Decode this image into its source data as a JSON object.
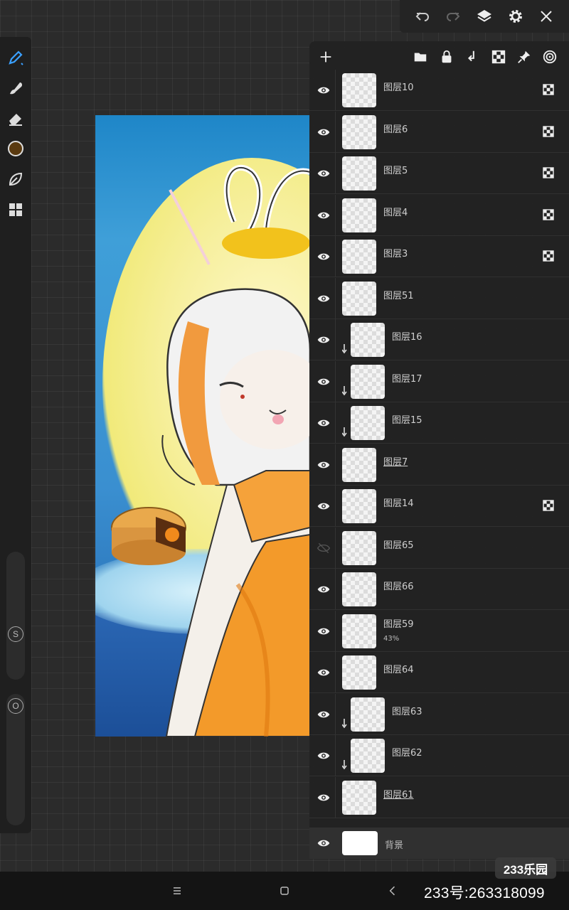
{
  "top_bar": {
    "icons": [
      "undo-icon",
      "redo-icon",
      "layers-icon",
      "gear-icon",
      "close-icon"
    ]
  },
  "left_rail": {
    "tools": [
      "brush-icon",
      "smudge-icon",
      "eraser-icon",
      "color-swatch",
      "leaf-icon",
      "grid-icon"
    ],
    "current_color": "#5a3a10",
    "size_slider_label": "S",
    "opacity_slider_label": "O"
  },
  "layer_panel": {
    "toolbar_icons": [
      "add-layer-icon",
      "folder-icon",
      "lock-icon",
      "merge-down-icon",
      "alpha-lock-icon",
      "pin-icon",
      "target-icon"
    ],
    "layers": [
      {
        "name": "图层10",
        "visible": true,
        "clipped": false,
        "alpha_locked": true,
        "underlined": false,
        "opacity": ""
      },
      {
        "name": "图层6",
        "visible": true,
        "clipped": false,
        "alpha_locked": true,
        "underlined": false,
        "opacity": ""
      },
      {
        "name": "图层5",
        "visible": true,
        "clipped": false,
        "alpha_locked": true,
        "underlined": false,
        "opacity": ""
      },
      {
        "name": "图层4",
        "visible": true,
        "clipped": false,
        "alpha_locked": true,
        "underlined": false,
        "opacity": ""
      },
      {
        "name": "图层3",
        "visible": true,
        "clipped": false,
        "alpha_locked": true,
        "underlined": false,
        "opacity": ""
      },
      {
        "name": "图层51",
        "visible": true,
        "clipped": false,
        "alpha_locked": false,
        "underlined": false,
        "opacity": ""
      },
      {
        "name": "图层16",
        "visible": true,
        "clipped": true,
        "alpha_locked": false,
        "underlined": false,
        "opacity": ""
      },
      {
        "name": "图层17",
        "visible": true,
        "clipped": true,
        "alpha_locked": false,
        "underlined": false,
        "opacity": ""
      },
      {
        "name": "图层15",
        "visible": true,
        "clipped": true,
        "alpha_locked": false,
        "underlined": false,
        "opacity": ""
      },
      {
        "name": "图层7",
        "visible": true,
        "clipped": false,
        "alpha_locked": false,
        "underlined": true,
        "opacity": ""
      },
      {
        "name": "图层14",
        "visible": true,
        "clipped": false,
        "alpha_locked": true,
        "underlined": false,
        "opacity": ""
      },
      {
        "name": "图层65",
        "visible": false,
        "clipped": false,
        "alpha_locked": false,
        "underlined": false,
        "opacity": ""
      },
      {
        "name": "图层66",
        "visible": true,
        "clipped": false,
        "alpha_locked": false,
        "underlined": false,
        "opacity": ""
      },
      {
        "name": "图层59",
        "visible": true,
        "clipped": false,
        "alpha_locked": false,
        "underlined": false,
        "opacity": "43%"
      },
      {
        "name": "图层64",
        "visible": true,
        "clipped": false,
        "alpha_locked": false,
        "underlined": false,
        "opacity": ""
      },
      {
        "name": "图层63",
        "visible": true,
        "clipped": true,
        "alpha_locked": false,
        "underlined": false,
        "opacity": ""
      },
      {
        "name": "图层62",
        "visible": true,
        "clipped": true,
        "alpha_locked": false,
        "underlined": false,
        "opacity": ""
      },
      {
        "name": "图层61",
        "visible": true,
        "clipped": false,
        "alpha_locked": false,
        "underlined": true,
        "opacity": ""
      }
    ],
    "background_layer": {
      "name": "背景",
      "visible": true
    }
  },
  "nav_bar": {
    "icons": [
      "menu-icon",
      "home-icon",
      "back-icon"
    ]
  },
  "watermark": {
    "badge": "233乐园",
    "id_text": "233号:263318099"
  }
}
